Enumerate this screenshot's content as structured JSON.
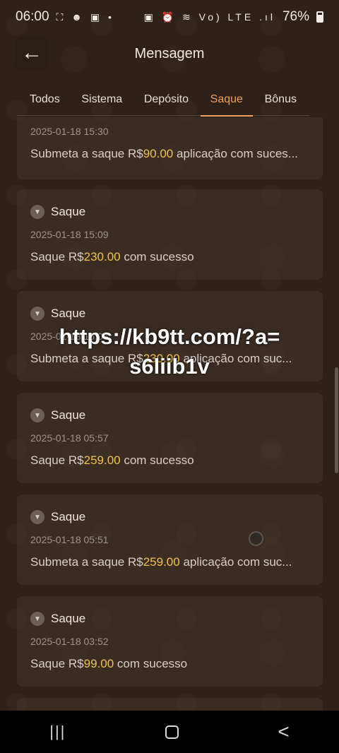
{
  "status_bar": {
    "time": "06:00",
    "left_icons": "⛶ ☻ ▣ •",
    "right_icons": "▣ ⏰ ≋ Vo) LTE .ıl",
    "battery": "76%"
  },
  "header": {
    "title": "Mensagem",
    "back_icon": "←"
  },
  "tabs": [
    {
      "label": "Todos",
      "active": false
    },
    {
      "label": "Sistema",
      "active": false
    },
    {
      "label": "Depósito",
      "active": false
    },
    {
      "label": "Saque",
      "active": true
    },
    {
      "label": "Bônus",
      "active": false
    }
  ],
  "messages": [
    {
      "type": "",
      "date": "2025-01-18 15:30",
      "prefix": "Submeta a saque R$",
      "amount": "90.00",
      "suffix": " aplicação com suces..."
    },
    {
      "type": "Saque",
      "date": "2025-01-18 15:09",
      "prefix": "Saque R$",
      "amount": "230.00",
      "suffix": " com sucesso"
    },
    {
      "type": "Saque",
      "date": "2025-01-18 15:03",
      "prefix": "Submeta a saque R$",
      "amount": "230.00",
      "suffix": " aplicação com suc..."
    },
    {
      "type": "Saque",
      "date": "2025-01-18 05:57",
      "prefix": "Saque R$",
      "amount": "259.00",
      "suffix": " com sucesso"
    },
    {
      "type": "Saque",
      "date": "2025-01-18 05:51",
      "prefix": "Submeta a saque R$",
      "amount": "259.00",
      "suffix": " aplicação com suc..."
    },
    {
      "type": "Saque",
      "date": "2025-01-18 03:52",
      "prefix": "Saque R$",
      "amount": "99.00",
      "suffix": " com sucesso"
    }
  ],
  "watermark": {
    "line1": "https://kb9tt.com/?a=",
    "line2": "s6liib1v"
  },
  "navbar": {
    "recent": "|||",
    "back": "<"
  },
  "colors": {
    "accent": "#f2a15c",
    "amount": "#f0c24a",
    "background": "#2d2119"
  }
}
